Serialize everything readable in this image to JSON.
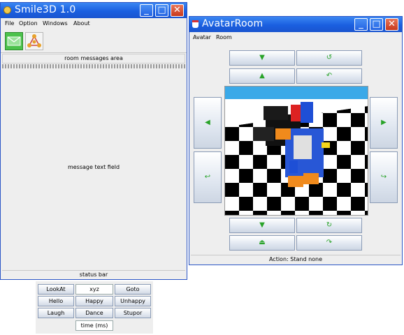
{
  "smile_window": {
    "title": "Smile3D 1.0",
    "menu": [
      "File",
      "Option",
      "Windows",
      "About"
    ],
    "toolbar": [
      "envelope-icon",
      "network-icon"
    ],
    "room_messages": "room messages area",
    "message_text": "message text field",
    "status": "status bar"
  },
  "avatar_window": {
    "title": "AvatarRoom",
    "menu": [
      "Avatar",
      "Room"
    ],
    "status": "Action: Stand none"
  },
  "actions": {
    "row1": [
      "LookAt",
      "xyz",
      "Goto"
    ],
    "row2": [
      "Hello",
      "Happy",
      "Unhappy"
    ],
    "row3": [
      "Laugh",
      "Dance",
      "Stupor"
    ],
    "time_field": "time (ms)"
  },
  "colors": {
    "titlebar": "#1a5fe0",
    "arrow": "#29a329",
    "sky": "#3aa9e8"
  }
}
